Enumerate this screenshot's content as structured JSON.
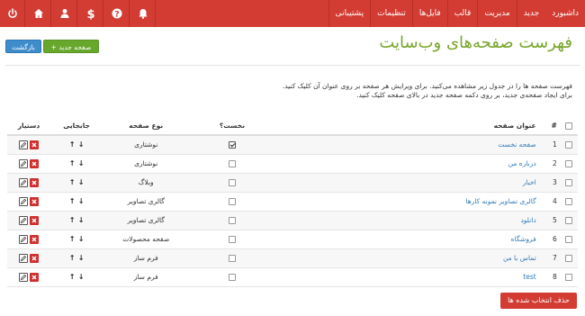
{
  "topbar": {
    "nav": [
      "داشبورد",
      "جدید",
      "مدیریت",
      "قالب",
      "فایل‌ها",
      "تنظیمات",
      "پشتیبانی"
    ],
    "icons": [
      "power-icon",
      "home-icon",
      "user-icon",
      "dollar-icon",
      "help-icon",
      "bell-icon"
    ]
  },
  "header": {
    "title": "فهرست صفحه‌های وب‌سایت",
    "new_label": "+ صفحه جدید",
    "back_label": "بازگشت"
  },
  "intro": {
    "line1": "فهرست صفحه ها را در جدول زیر مشاهده می‌کنید. برای ویرایش هر صفحه بر روی عنوان آن کلیک کنید.",
    "line2": "برای ایجاد صفحه‌ی جدید، بر روی دکمه صفحه جدید در بالای صفحه کلیک کنید."
  },
  "table": {
    "headers": {
      "num": "#",
      "title": "عنوان صفحه",
      "first": "نخست؟",
      "type": "نوع صفحه",
      "move": "جابجایی",
      "tools": "دستیار"
    },
    "rows": [
      {
        "num": "1",
        "title": "صفحه نخست",
        "first": true,
        "type": "نوشتاری"
      },
      {
        "num": "2",
        "title": "درباره من",
        "first": false,
        "type": "نوشتاری"
      },
      {
        "num": "3",
        "title": "اخبار",
        "first": false,
        "type": "وبلاگ"
      },
      {
        "num": "4",
        "title": "گالری تصاویر نمونه کارها",
        "first": false,
        "type": "گالری تصاویر"
      },
      {
        "num": "5",
        "title": "دانلود",
        "first": false,
        "type": "گالری تصاویر"
      },
      {
        "num": "6",
        "title": "فروشگاه",
        "first": false,
        "type": "صفحه محصولات"
      },
      {
        "num": "7",
        "title": "تماس با من",
        "first": false,
        "type": "فرم ساز"
      },
      {
        "num": "8",
        "title": "test",
        "first": false,
        "type": "فرم ساز"
      }
    ]
  },
  "footer": {
    "delete_selected_label": "حذف انتخاب شده ها"
  },
  "colors": {
    "topbar": "#d33c33",
    "title": "#78a52a",
    "link": "#2f7ab8",
    "new_button": "#67a72c",
    "back_button": "#3f8ccb"
  }
}
